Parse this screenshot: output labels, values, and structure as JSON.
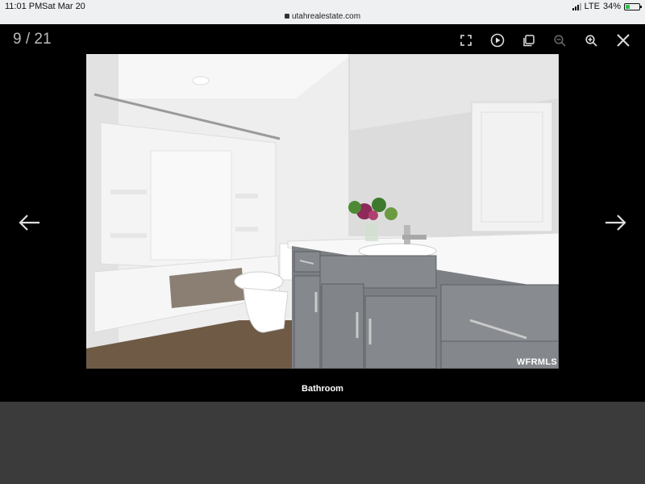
{
  "status_bar": {
    "time": "11:01 PM",
    "date": "Sat Mar 20",
    "url": "utahrealestate.com",
    "network": "LTE",
    "battery": "34%",
    "battery_level": 0.34
  },
  "viewer": {
    "counter": "9 / 21",
    "caption": "Bathroom",
    "watermark": "WFRMLS",
    "toolbar": [
      {
        "name": "fullscreen-icon"
      },
      {
        "name": "play-icon"
      },
      {
        "name": "copy-icon"
      },
      {
        "name": "zoom-out-icon"
      },
      {
        "name": "zoom-in-icon"
      },
      {
        "name": "close-icon"
      }
    ],
    "nav": {
      "prev": "arrow-left-icon",
      "next": "arrow-right-icon"
    }
  },
  "colors": {
    "viewer_bg": "#000000",
    "page_bg": "#3b3b3b",
    "cabinet": "#7c7f83",
    "floor": "#6e5a45",
    "wall": "#f1f1f1"
  }
}
